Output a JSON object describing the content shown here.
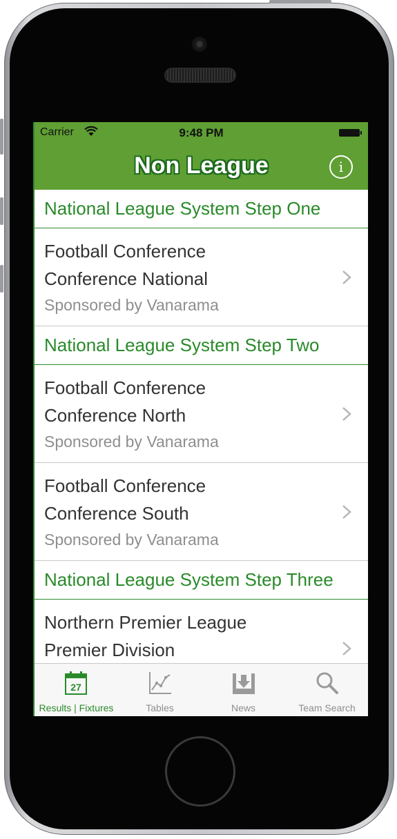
{
  "status": {
    "carrier": "Carrier",
    "time": "9:48 PM"
  },
  "nav": {
    "title": "Non League",
    "info_icon": "info-icon",
    "info_glyph": "i"
  },
  "colors": {
    "accent": "#5f9f33",
    "section_text": "#2a8a2a",
    "subtitle": "#8e8e8e"
  },
  "sections": [
    {
      "header": "National League System Step One",
      "rows": [
        {
          "line1": "Football Conference",
          "line2": "Conference National",
          "line3": "Sponsored by Vanarama"
        }
      ]
    },
    {
      "header": "National League System Step Two",
      "rows": [
        {
          "line1": "Football Conference",
          "line2": "Conference North",
          "line3": "Sponsored by Vanarama"
        },
        {
          "line1": "Football Conference",
          "line2": "Conference South",
          "line3": "Sponsored by Vanarama"
        }
      ]
    },
    {
      "header": "National League System Step Three",
      "rows": [
        {
          "line1": "Northern Premier League",
          "line2": "Premier Division",
          "line3": ""
        }
      ]
    }
  ],
  "tabs": [
    {
      "label": "Results | Fixtures",
      "icon": "calendar-icon",
      "calendar_day": "27",
      "active": true
    },
    {
      "label": "Tables",
      "icon": "chart-icon",
      "active": false
    },
    {
      "label": "News",
      "icon": "download-icon",
      "active": false
    },
    {
      "label": "Team Search",
      "icon": "search-icon",
      "active": false
    }
  ]
}
